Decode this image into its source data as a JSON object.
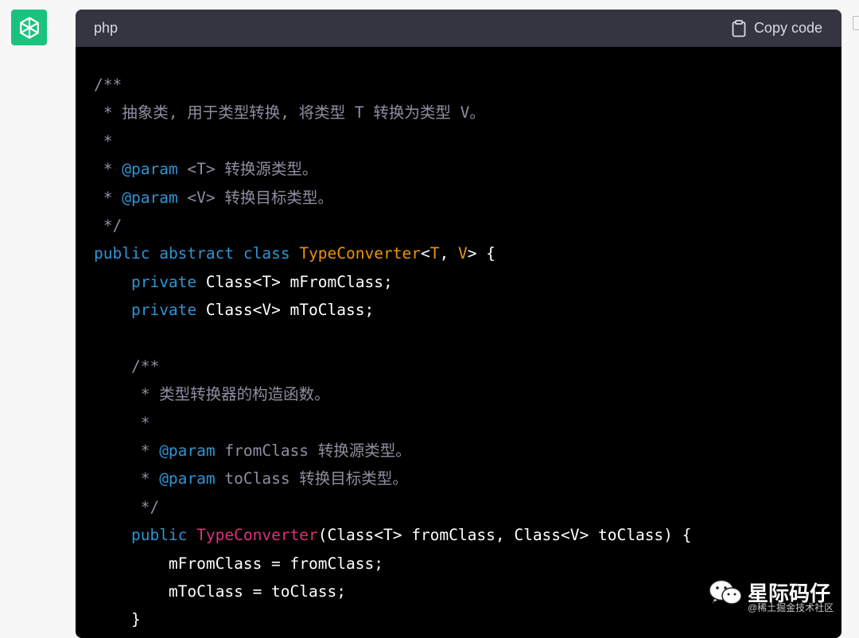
{
  "code_block": {
    "language": "php",
    "copy_label": "Copy code"
  },
  "code_lines": [
    [
      {
        "c": "c",
        "t": "/**"
      }
    ],
    [
      {
        "c": "c",
        "t": " * 抽象类, 用于类型转换, 将类型 T 转换为类型 V。"
      }
    ],
    [
      {
        "c": "c",
        "t": " *"
      }
    ],
    [
      {
        "c": "c",
        "t": " * "
      },
      {
        "c": "k",
        "t": "@param"
      },
      {
        "c": "c",
        "t": " <T> 转换源类型。"
      }
    ],
    [
      {
        "c": "c",
        "t": " * "
      },
      {
        "c": "k",
        "t": "@param"
      },
      {
        "c": "c",
        "t": " <V> 转换目标类型。"
      }
    ],
    [
      {
        "c": "c",
        "t": " */"
      }
    ],
    [
      {
        "c": "k",
        "t": "public"
      },
      {
        "c": "p",
        "t": " "
      },
      {
        "c": "k",
        "t": "abstract"
      },
      {
        "c": "p",
        "t": " "
      },
      {
        "c": "k",
        "t": "class"
      },
      {
        "c": "p",
        "t": " "
      },
      {
        "c": "t",
        "t": "TypeConverter"
      },
      {
        "c": "p",
        "t": "<"
      },
      {
        "c": "t",
        "t": "T"
      },
      {
        "c": "p",
        "t": ", "
      },
      {
        "c": "t",
        "t": "V"
      },
      {
        "c": "p",
        "t": "> {"
      }
    ],
    [
      {
        "c": "p",
        "t": "    "
      },
      {
        "c": "k",
        "t": "private"
      },
      {
        "c": "p",
        "t": " Class<T> mFromClass;"
      }
    ],
    [
      {
        "c": "p",
        "t": "    "
      },
      {
        "c": "k",
        "t": "private"
      },
      {
        "c": "p",
        "t": " Class<V> mToClass;"
      }
    ],
    [
      {
        "c": "p",
        "t": ""
      }
    ],
    [
      {
        "c": "c",
        "t": "    /**"
      }
    ],
    [
      {
        "c": "c",
        "t": "     * 类型转换器的构造函数。"
      }
    ],
    [
      {
        "c": "c",
        "t": "     *"
      }
    ],
    [
      {
        "c": "c",
        "t": "     * "
      },
      {
        "c": "k",
        "t": "@param"
      },
      {
        "c": "c",
        "t": " fromClass 转换源类型。"
      }
    ],
    [
      {
        "c": "c",
        "t": "     * "
      },
      {
        "c": "k",
        "t": "@param"
      },
      {
        "c": "c",
        "t": " toClass 转换目标类型。"
      }
    ],
    [
      {
        "c": "c",
        "t": "     */"
      }
    ],
    [
      {
        "c": "p",
        "t": "    "
      },
      {
        "c": "k",
        "t": "public"
      },
      {
        "c": "p",
        "t": " "
      },
      {
        "c": "f",
        "t": "TypeConverter"
      },
      {
        "c": "p",
        "t": "(Class<T> fromClass, Class<V> toClass) {"
      }
    ],
    [
      {
        "c": "p",
        "t": "        mFromClass = fromClass;"
      }
    ],
    [
      {
        "c": "p",
        "t": "        mToClass = toClass;"
      }
    ],
    [
      {
        "c": "p",
        "t": "    }"
      }
    ]
  ],
  "watermark": {
    "name": "星际码仔",
    "sub": "@稀土掘金技术社区"
  },
  "colors": {
    "avatar_bg": "#19c37d",
    "header_bg": "#343541",
    "code_bg": "#000000",
    "comment": "#8e8ea0",
    "keyword": "#2e95d3",
    "type": "#e9950c",
    "function": "#df3079"
  },
  "icons": [
    "openai-logo-icon",
    "clipboard-icon",
    "wechat-icon"
  ]
}
